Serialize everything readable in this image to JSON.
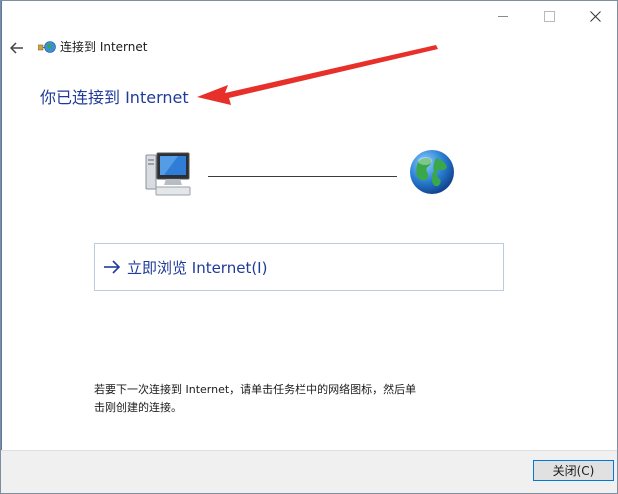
{
  "window": {
    "title": "连接到 Internet",
    "caption_buttons": [
      "minimize",
      "maximize",
      "close"
    ]
  },
  "nav": {
    "back_icon": "back-arrow-icon",
    "title_icon": "network-connection-icon"
  },
  "main": {
    "heading": "你已连接到 Internet",
    "computer_icon": "computer-icon",
    "globe_icon": "globe-icon",
    "browse_link": {
      "icon": "right-arrow-icon",
      "label": "立即浏览 Internet(I)"
    },
    "hint_line1": "若要下一次连接到 Internet，请单击任务栏中的网络图标，然后单",
    "hint_line2": "击刚创建的连接。"
  },
  "footer": {
    "close_label": "关闭(C)"
  },
  "colors": {
    "link_blue": "#1f3b99",
    "annotation_red": "#e8302b",
    "footer_bg": "#f0f0f0",
    "focus_border": "#0078d7"
  }
}
